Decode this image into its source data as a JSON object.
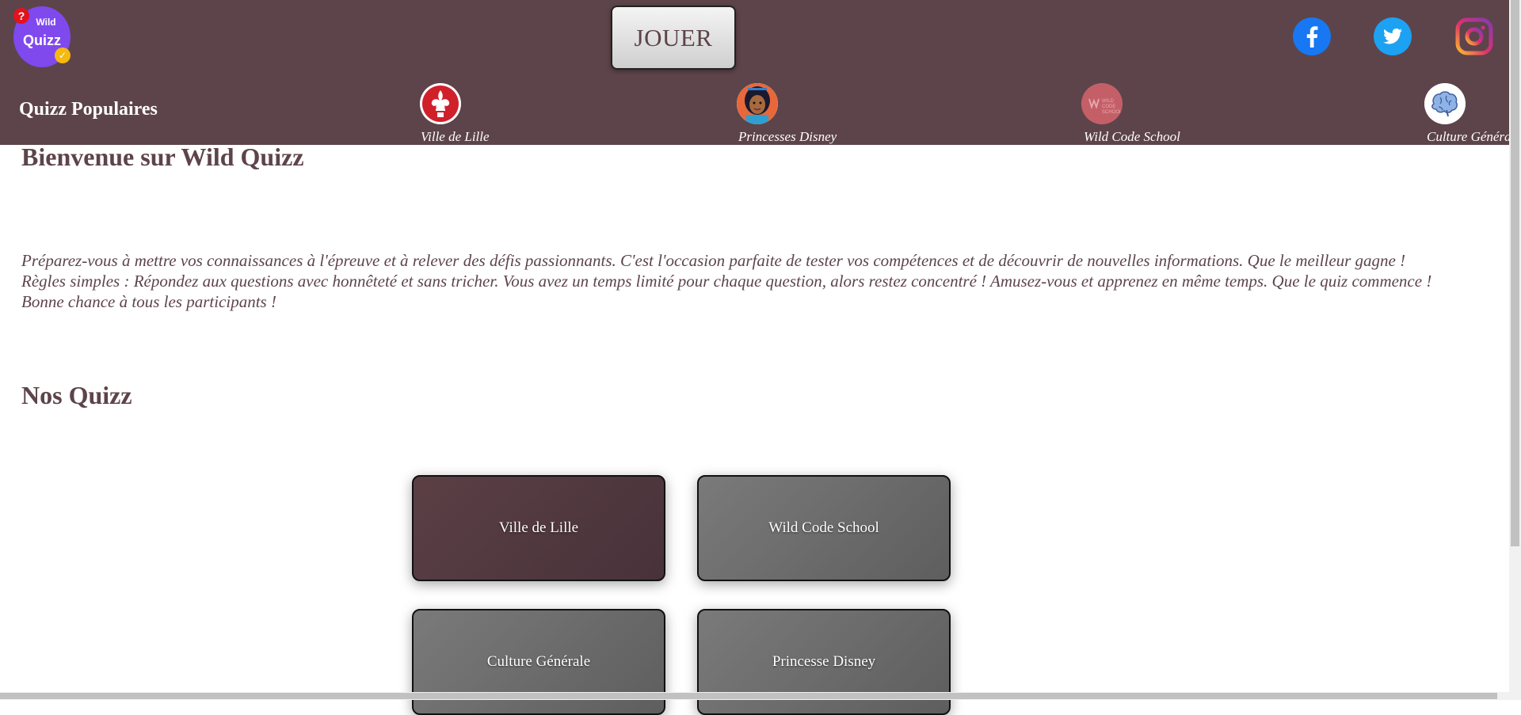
{
  "header": {
    "logo": {
      "line1": "Wild",
      "line2": "Quizz",
      "badge": "?"
    },
    "play_button": "JOUER",
    "social": [
      {
        "icon": "facebook-icon"
      },
      {
        "icon": "twitter-icon"
      },
      {
        "icon": "instagram-icon"
      }
    ]
  },
  "popular": {
    "title": "Quizz Populaires",
    "items": [
      {
        "label": "Ville de Lille",
        "icon": "fleur-de-lis-icon"
      },
      {
        "label": "Princesses Disney",
        "icon": "princess-avatar-icon"
      },
      {
        "label": "Wild Code School",
        "icon": "wild-code-school-icon"
      },
      {
        "label": "Culture Générale",
        "icon": "brain-icon"
      }
    ]
  },
  "main": {
    "welcome_title": "Bienvenue sur Wild Quizz",
    "intro": "Préparez-vous à mettre vos connaissances à l'épreuve et à relever des défis passionnants. C'est l'occasion parfaite de tester vos compétences et de découvrir de nouvelles informations. Que le meilleur gagne ! Règles simples : Répondez aux questions avec honnêteté et sans tricher. Vous avez un temps limité pour chaque question, alors restez concentré ! Amusez-vous et apprenez en même temps. Que le quiz commence ! Bonne chance à tous les participants !",
    "our_quizz_title": "Nos Quizz",
    "cards": [
      {
        "label": "Ville de Lille"
      },
      {
        "label": "Wild Code School"
      },
      {
        "label": "Culture Générale"
      },
      {
        "label": "Princesse Disney"
      }
    ]
  },
  "colors": {
    "header_bg": "#5d444a",
    "text_primary": "#5d444a",
    "active_card": "#5b3f45",
    "inactive_card": "#6e6e6e",
    "logo_purple": "#7f49ee"
  }
}
